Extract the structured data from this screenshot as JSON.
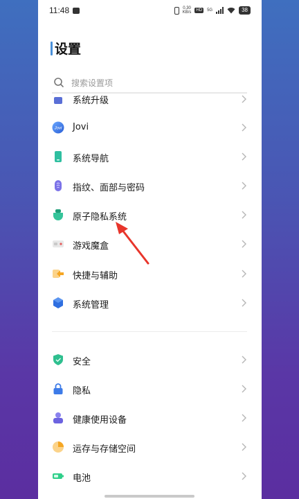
{
  "status_bar": {
    "time": "11:48",
    "speed_top": "0.30",
    "speed_bottom": "KB/s",
    "hd": "HD",
    "network": "5G",
    "battery": "38"
  },
  "page": {
    "title": "设置"
  },
  "search": {
    "placeholder": "搜索设置项"
  },
  "items": [
    {
      "label": "系统升级",
      "icon": "system-update-icon",
      "color": "#5a6fd6"
    },
    {
      "label": "Jovi",
      "icon": "jovi-icon",
      "color": "#3d78e8"
    },
    {
      "label": "系统导航",
      "icon": "phone-navigation-icon",
      "color": "#2fbfa0"
    },
    {
      "label": "指纹、面部与密码",
      "icon": "fingerprint-icon",
      "color": "#7b72e8"
    },
    {
      "label": "原子隐私系统",
      "icon": "atom-privacy-icon",
      "color": "#35c49a"
    },
    {
      "label": "游戏魔盒",
      "icon": "game-box-icon",
      "color": "#e45a5a"
    },
    {
      "label": "快捷与辅助",
      "icon": "shortcut-icon",
      "color": "#f5a623"
    },
    {
      "label": "系统管理",
      "icon": "system-management-icon",
      "color": "#2f6fe0"
    },
    {
      "label": "安全",
      "icon": "shield-icon",
      "color": "#2fbf8f"
    },
    {
      "label": "隐私",
      "icon": "lock-icon",
      "color": "#3d7be8"
    },
    {
      "label": "健康使用设备",
      "icon": "health-usage-icon",
      "color": "#6c63e0"
    },
    {
      "label": "运存与存储空间",
      "icon": "storage-pie-icon",
      "color": "#f5a623"
    },
    {
      "label": "电池",
      "icon": "battery-icon",
      "color": "#2fcf8a"
    }
  ]
}
